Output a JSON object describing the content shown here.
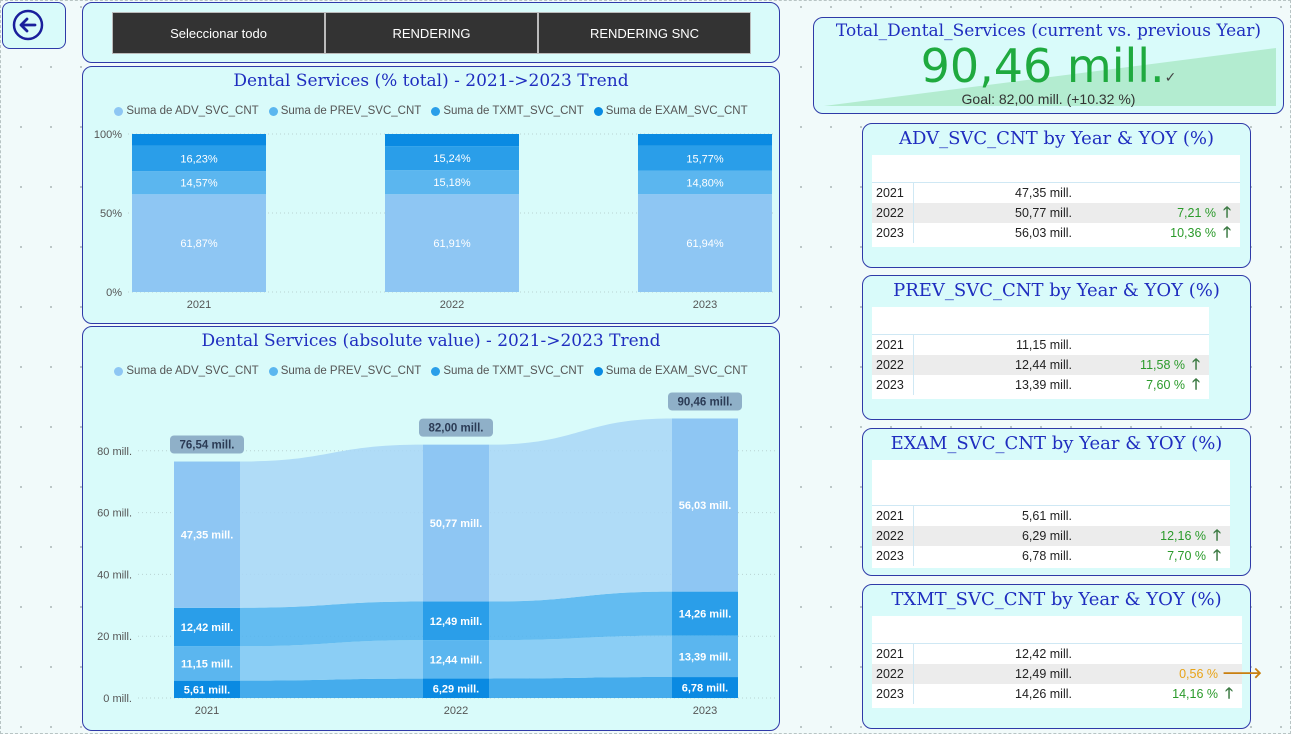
{
  "buttons": {
    "select_all": "Seleccionar todo",
    "rendering": "RENDERING",
    "rendering_snc": "RENDERING SNC"
  },
  "kpi": {
    "title": "Total_Dental_Services (current vs. previous Year)",
    "value": "90,46 mill.",
    "goal_text": "Goal: 82,00 mill. (+10.32 %)",
    "check_glyph": "✓"
  },
  "legend": [
    {
      "label": "Suma de ADV_SVC_CNT",
      "color": "#8ec6f3"
    },
    {
      "label": "Suma de PREV_SVC_CNT",
      "color": "#5bb6ef"
    },
    {
      "label": "Suma de TXMT_SVC_CNT",
      "color": "#2a9ee9"
    },
    {
      "label": "Suma de EXAM_SVC_CNT",
      "color": "#0a8ae2"
    }
  ],
  "chart_data": [
    {
      "type": "bar",
      "title": "Dental Services (% total) - 2021->2023 Trend",
      "categories": [
        "2021",
        "2022",
        "2023"
      ],
      "y_ticks": [
        "0%",
        "50%",
        "100%"
      ],
      "ylim": [
        0,
        100
      ],
      "stacked": true,
      "series": [
        {
          "name": "Suma de ADV_SVC_CNT",
          "values": [
            61.87,
            61.91,
            61.94
          ],
          "labels": [
            "61,87%",
            "61,91%",
            "61,94%"
          ],
          "color": "#8ec6f3"
        },
        {
          "name": "Suma de PREV_SVC_CNT",
          "values": [
            14.57,
            15.18,
            14.8
          ],
          "labels": [
            "14,57%",
            "15,18%",
            "14,80%"
          ],
          "color": "#5bb6ef"
        },
        {
          "name": "Suma de TXMT_SVC_CNT",
          "values": [
            16.23,
            15.24,
            15.77
          ],
          "labels": [
            "16,23%",
            "15,24%",
            "15,77%"
          ],
          "color": "#2a9ee9"
        },
        {
          "name": "Suma de EXAM_SVC_CNT",
          "values": [
            7.33,
            7.67,
            7.49
          ],
          "labels": [
            "",
            "",
            ""
          ],
          "color": "#0a8ae2"
        }
      ]
    },
    {
      "type": "area",
      "title": "Dental Services (absolute value) - 2021->2023 Trend",
      "categories": [
        "2021",
        "2022",
        "2023"
      ],
      "y_ticks": [
        "0 mill.",
        "20 mill.",
        "40 mill.",
        "60 mill.",
        "80 mill."
      ],
      "ylim": [
        0,
        90
      ],
      "stacked": true,
      "totals": [
        "76,54 mill.",
        "82,00 mill.",
        "90,46 mill."
      ],
      "total_values": [
        76.54,
        82.0,
        90.46
      ],
      "series": [
        {
          "name": "Suma de EXAM_SVC_CNT",
          "values": [
            5.61,
            6.29,
            6.78
          ],
          "labels": [
            "5,61 mill.",
            "6,29 mill.",
            "6,78 mill."
          ],
          "color": "#0a8ae2",
          "ribbon": "#2a9ee9"
        },
        {
          "name": "Suma de PREV_SVC_CNT",
          "values": [
            11.15,
            12.44,
            13.39
          ],
          "labels": [
            "11,15 mill.",
            "12,44 mill.",
            "13,39 mill."
          ],
          "color": "#5bb6ef",
          "ribbon": "#7cc6f3"
        },
        {
          "name": "Suma de TXMT_SVC_CNT",
          "values": [
            12.42,
            12.49,
            14.26
          ],
          "labels": [
            "12,42 mill.",
            "12,49 mill.",
            "14,26 mill."
          ],
          "color": "#2a9ee9",
          "ribbon": "#4db0ee"
        },
        {
          "name": "Suma de ADV_SVC_CNT",
          "values": [
            47.35,
            50.77,
            56.03
          ],
          "labels": [
            "47,35 mill.",
            "50,77 mill.",
            "56,03 mill."
          ],
          "color": "#8ec6f3",
          "ribbon": "#a8d6f6"
        }
      ]
    }
  ],
  "mini_tables": [
    {
      "title": "ADV_SVC_CNT by Year & YOY (%)",
      "rows": [
        {
          "year": "2021",
          "value": "47,35 mill.",
          "yoy": "",
          "arrow": "",
          "color": ""
        },
        {
          "year": "2022",
          "value": "50,77 mill.",
          "yoy": "7,21 %",
          "arrow": "🡑",
          "color": "#2a9a2a"
        },
        {
          "year": "2023",
          "value": "56,03 mill.",
          "yoy": "10,36 %",
          "arrow": "🡑",
          "color": "#2a9a2a"
        }
      ]
    },
    {
      "title": "PREV_SVC_CNT by Year & YOY (%)",
      "rows": [
        {
          "year": "2021",
          "value": "11,15 mill.",
          "yoy": "",
          "arrow": "",
          "color": ""
        },
        {
          "year": "2022",
          "value": "12,44 mill.",
          "yoy": "11,58 %",
          "arrow": "🡑",
          "color": "#2a9a2a"
        },
        {
          "year": "2023",
          "value": "13,39 mill.",
          "yoy": "7,60 %",
          "arrow": "🡑",
          "color": "#2a9a2a"
        }
      ]
    },
    {
      "title": "EXAM_SVC_CNT by Year & YOY (%)",
      "rows": [
        {
          "year": "2021",
          "value": "5,61 mill.",
          "yoy": "",
          "arrow": "",
          "color": ""
        },
        {
          "year": "2022",
          "value": "6,29 mill.",
          "yoy": "12,16 %",
          "arrow": "🡑",
          "color": "#2a9a2a"
        },
        {
          "year": "2023",
          "value": "6,78 mill.",
          "yoy": "7,70 %",
          "arrow": "🡑",
          "color": "#2a9a2a"
        }
      ]
    },
    {
      "title": "TXMT_SVC_CNT by Year & YOY (%)",
      "rows": [
        {
          "year": "2021",
          "value": "12,42 mill.",
          "yoy": "",
          "arrow": "",
          "color": ""
        },
        {
          "year": "2022",
          "value": "12,49 mill.",
          "yoy": "0,56 %",
          "arrow": "🡒",
          "color": "#e8a317"
        },
        {
          "year": "2023",
          "value": "14,26 mill.",
          "yoy": "14,16 %",
          "arrow": "🡑",
          "color": "#2a9a2a"
        }
      ]
    }
  ],
  "colors": {
    "panel_bg": "#d9fbfa",
    "panel_border": "#2f3aa8",
    "title": "#1f2dbf",
    "kpi_value": "#1faa3f",
    "up": "#2a9a2a",
    "flat": "#e8a317",
    "arrow_up_icon": "#3c7a43"
  }
}
